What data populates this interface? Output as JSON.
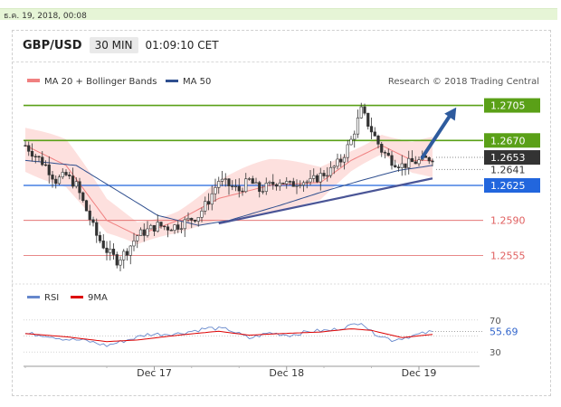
{
  "timestamp": "ธ.ค. 19, 2018, 00:08",
  "header": {
    "pair": "GBP/USD",
    "timeframe": "30 MIN",
    "time": "01:09:10 CET"
  },
  "legend": {
    "ma20": "MA 20 + Bollinger Bands",
    "ma50": "MA 50",
    "credit": "Research © 2018 Trading Central"
  },
  "rsi_legend": {
    "rsi": "RSI",
    "ma9": "9MA"
  },
  "colors": {
    "ma20": "#f08080",
    "ma50": "#2f4f8f",
    "bollinger_fill": "#fde0de",
    "resistance": "#5aa017",
    "current": "#333333",
    "support_blue": "#2266dd",
    "support_red": "#e06060",
    "trend_arrow": "#2e5b9e",
    "trendline": "#4a5596",
    "candle": "#333333",
    "rsi_line": "#6688cc",
    "rsi_ma": "#dd0000"
  },
  "chart_data": [
    {
      "type": "line",
      "chart_kind": "candlestick",
      "title": "GBP/USD 30 MIN",
      "y_scale": "linear",
      "ylim": [
        1.253,
        1.272
      ],
      "x_ticks": [
        "Dec 17",
        "Dec 18",
        "Dec 19"
      ],
      "price_levels": [
        {
          "value": 1.2705,
          "label": "1.2705",
          "kind": "resistance"
        },
        {
          "value": 1.267,
          "label": "1.2670",
          "kind": "resistance"
        },
        {
          "value": 1.2653,
          "label": "1.2653",
          "kind": "current"
        },
        {
          "value": 1.2641,
          "label": "1.2641",
          "kind": "reference"
        },
        {
          "value": 1.2625,
          "label": "1.2625",
          "kind": "pivot"
        },
        {
          "value": 1.259,
          "label": "1.2590",
          "kind": "support"
        },
        {
          "value": 1.2555,
          "label": "1.2555",
          "kind": "support"
        }
      ],
      "close_anchors": [
        [
          0,
          1.2665
        ],
        [
          3,
          1.2655
        ],
        [
          6,
          1.2645
        ],
        [
          9,
          1.263
        ],
        [
          12,
          1.2635
        ],
        [
          15,
          1.2625
        ],
        [
          18,
          1.26
        ],
        [
          21,
          1.2575
        ],
        [
          24,
          1.256
        ],
        [
          27,
          1.255
        ],
        [
          30,
          1.256
        ],
        [
          33,
          1.2575
        ],
        [
          36,
          1.258
        ],
        [
          39,
          1.2585
        ],
        [
          42,
          1.2583
        ],
        [
          45,
          1.2585
        ],
        [
          48,
          1.259
        ],
        [
          51,
          1.2595
        ],
        [
          54,
          1.261
        ],
        [
          57,
          1.263
        ],
        [
          60,
          1.2625
        ],
        [
          63,
          1.262
        ],
        [
          66,
          1.263
        ],
        [
          69,
          1.262
        ],
        [
          72,
          1.2625
        ],
        [
          75,
          1.263
        ],
        [
          78,
          1.2625
        ],
        [
          81,
          1.263
        ],
        [
          84,
          1.2628
        ],
        [
          87,
          1.2635
        ],
        [
          90,
          1.264
        ],
        [
          93,
          1.265
        ],
        [
          96,
          1.267
        ],
        [
          99,
          1.27
        ],
        [
          102,
          1.268
        ],
        [
          105,
          1.266
        ],
        [
          108,
          1.265
        ],
        [
          111,
          1.2645
        ],
        [
          114,
          1.2648
        ],
        [
          117,
          1.265
        ],
        [
          120,
          1.2653
        ]
      ],
      "ma20_anchors": [
        [
          0,
          1.2665
        ],
        [
          12,
          1.2645
        ],
        [
          24,
          1.259
        ],
        [
          33,
          1.2575
        ],
        [
          45,
          1.259
        ],
        [
          57,
          1.2612
        ],
        [
          72,
          1.2625
        ],
        [
          87,
          1.2628
        ],
        [
          96,
          1.265
        ],
        [
          105,
          1.2665
        ],
        [
          114,
          1.265
        ],
        [
          120,
          1.265
        ]
      ],
      "ma50_anchors": [
        [
          0,
          1.265
        ],
        [
          15,
          1.2645
        ],
        [
          27,
          1.262
        ],
        [
          39,
          1.2595
        ],
        [
          51,
          1.2585
        ],
        [
          60,
          1.259
        ],
        [
          75,
          1.2605
        ],
        [
          87,
          1.2618
        ],
        [
          99,
          1.263
        ],
        [
          110,
          1.264
        ],
        [
          120,
          1.2645
        ]
      ],
      "bollinger_width": 0.0022,
      "trendline": [
        [
          57,
          1.2587
        ],
        [
          120,
          1.2632
        ]
      ],
      "arrow": [
        [
          117,
          1.2653
        ],
        [
          127,
          1.2703
        ]
      ]
    },
    {
      "type": "line",
      "title": "RSI",
      "ylim": [
        20,
        80
      ],
      "y_ticks": [
        70,
        30
      ],
      "reference_lines": [
        70,
        50,
        30
      ],
      "current_label": "55.69",
      "series": [
        {
          "name": "RSI",
          "anchors": [
            [
              0,
              53
            ],
            [
              6,
              51
            ],
            [
              12,
              46
            ],
            [
              18,
              44
            ],
            [
              24,
              38
            ],
            [
              30,
              45
            ],
            [
              36,
              52
            ],
            [
              45,
              53
            ],
            [
              54,
              60
            ],
            [
              60,
              58
            ],
            [
              66,
              47
            ],
            [
              72,
              54
            ],
            [
              78,
              51
            ],
            [
              84,
              56
            ],
            [
              90,
              57
            ],
            [
              96,
              63
            ],
            [
              99,
              68
            ],
            [
              102,
              55
            ],
            [
              108,
              45
            ],
            [
              114,
              50
            ],
            [
              120,
              55.69
            ]
          ]
        },
        {
          "name": "9MA",
          "anchors": [
            [
              0,
              53
            ],
            [
              12,
              49
            ],
            [
              24,
              43
            ],
            [
              33,
              45
            ],
            [
              45,
              51
            ],
            [
              57,
              56
            ],
            [
              66,
              51
            ],
            [
              75,
              53
            ],
            [
              87,
              55
            ],
            [
              96,
              59
            ],
            [
              102,
              57
            ],
            [
              111,
              48
            ],
            [
              120,
              52
            ]
          ]
        }
      ]
    }
  ]
}
